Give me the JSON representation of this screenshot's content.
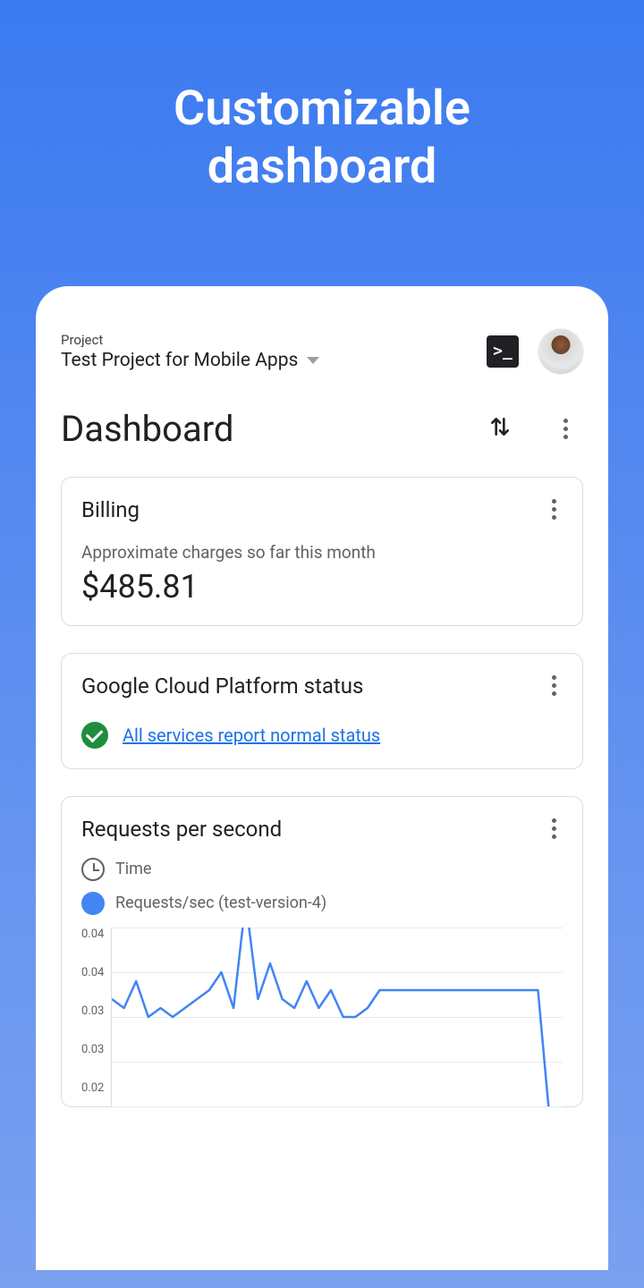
{
  "hero": {
    "line1": "Customizable",
    "line2": "dashboard"
  },
  "header": {
    "project_label": "Project",
    "project_name": "Test Project for Mobile Apps"
  },
  "page": {
    "title": "Dashboard"
  },
  "cards": {
    "billing": {
      "title": "Billing",
      "subtitle": "Approximate charges so far this month",
      "amount": "$485.81"
    },
    "status": {
      "title": "Google Cloud Platform status",
      "link_text": "All services report normal status"
    },
    "requests": {
      "title": "Requests per second",
      "legend_time": "Time",
      "legend_series": "Requests/sec (test-version-4)"
    }
  },
  "chart_data": {
    "type": "line",
    "title": "Requests per second",
    "ylabel": "",
    "xlabel": "Time",
    "ylim": [
      0.02,
      0.04
    ],
    "y_ticks": [
      "0.04",
      "0.04",
      "0.03",
      "0.03",
      "0.02"
    ],
    "series": [
      {
        "name": "Requests/sec (test-version-4)",
        "color": "#4285f4",
        "values": [
          0.032,
          0.031,
          0.034,
          0.03,
          0.031,
          0.03,
          0.031,
          0.032,
          0.033,
          0.035,
          0.031,
          0.043,
          0.032,
          0.036,
          0.032,
          0.031,
          0.034,
          0.031,
          0.033,
          0.03,
          0.03,
          0.031,
          0.033,
          0.033,
          0.033,
          0.033,
          0.033,
          0.033,
          0.033,
          0.033,
          0.033,
          0.033,
          0.033,
          0.033,
          0.033,
          0.033,
          0.018,
          0.017
        ]
      }
    ]
  }
}
